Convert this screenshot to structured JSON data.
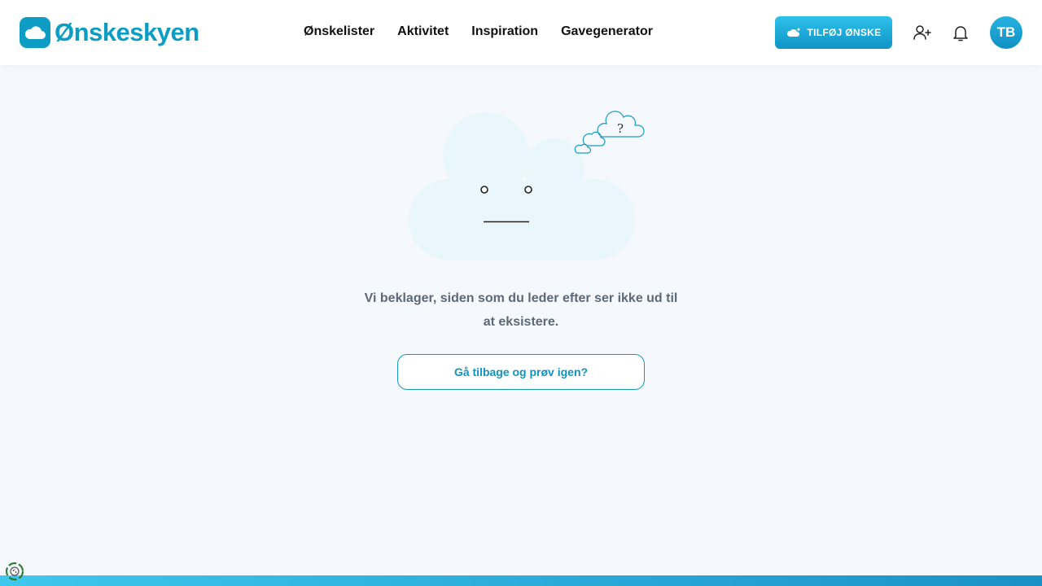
{
  "brand": {
    "name": "Ønskeskyen",
    "color": "#0d9dc4"
  },
  "nav": {
    "items": [
      {
        "label": "Ønskelister"
      },
      {
        "label": "Aktivitet"
      },
      {
        "label": "Inspiration"
      },
      {
        "label": "Gavegenerator"
      }
    ]
  },
  "header": {
    "add_wish_label": "TILFØJ ØNSKE",
    "avatar_initials": "TB",
    "icons": [
      "add-user-icon",
      "bell-icon"
    ]
  },
  "error": {
    "illustration": "sad-cloud-illustration",
    "message": "Vi beklager, siden som du leder efter ser ikke ud til at eksistere.",
    "back_button_label": "Gå tilbage og prøv igen?"
  },
  "footer": {
    "cookie_icon": "cookie-icon"
  },
  "colors": {
    "accent": "#0d9dc4",
    "background": "#f5f9fd",
    "cloud_fill": "#e9f6fb",
    "text_muted": "#5d6879"
  }
}
